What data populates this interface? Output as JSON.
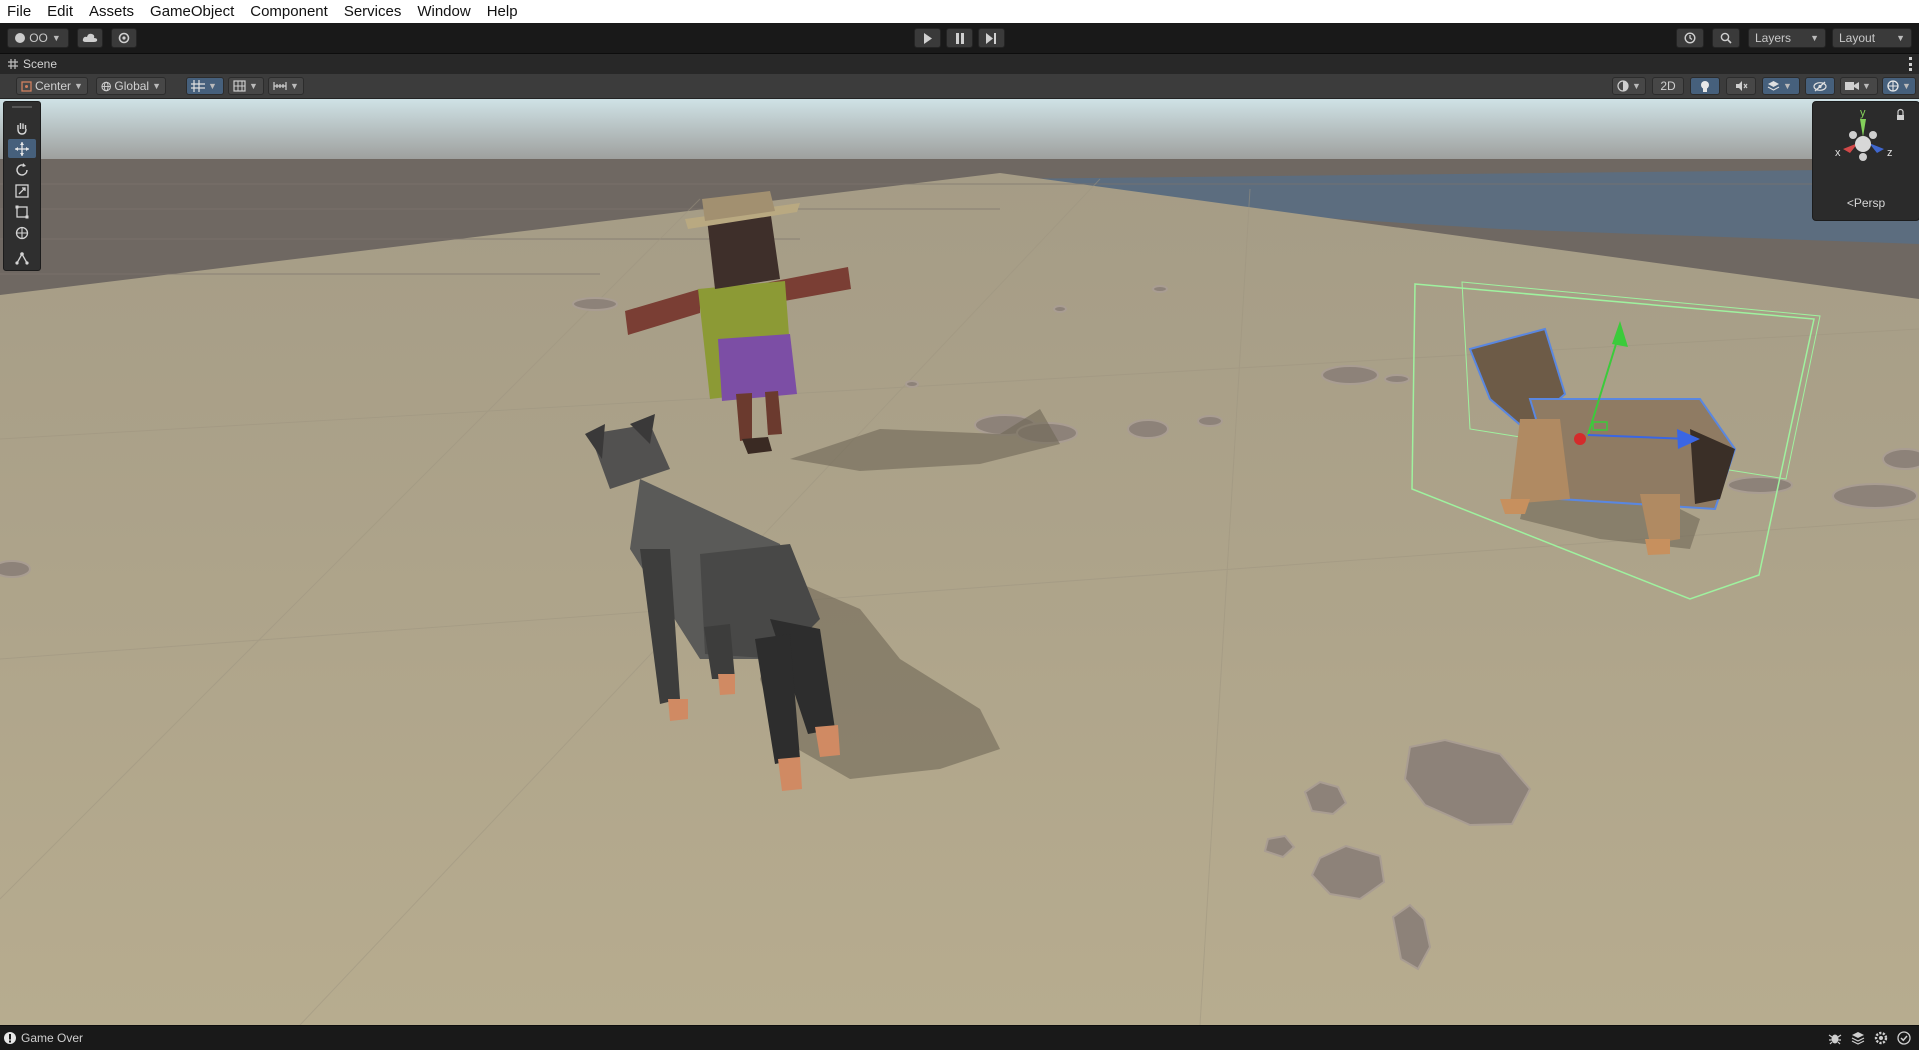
{
  "menu": [
    "File",
    "Edit",
    "Assets",
    "GameObject",
    "Component",
    "Services",
    "Window",
    "Help"
  ],
  "toolbar": {
    "account_label": "OO",
    "layers_label": "Layers",
    "layout_label": "Layout"
  },
  "scene_tab": {
    "label": "Scene"
  },
  "scene_toolbar": {
    "pivot_label": "Center",
    "space_label": "Global",
    "mode_2d_label": "2D"
  },
  "gizmo": {
    "y_label": "y",
    "x_label": "x",
    "z_label": "z",
    "projection_label": "Persp"
  },
  "status": {
    "message": "Game Over"
  },
  "colors": {
    "accent": "#46607c",
    "ground": "#b1a788",
    "selection_outline": "#5a87e0",
    "bounds": "#9ff29f"
  }
}
